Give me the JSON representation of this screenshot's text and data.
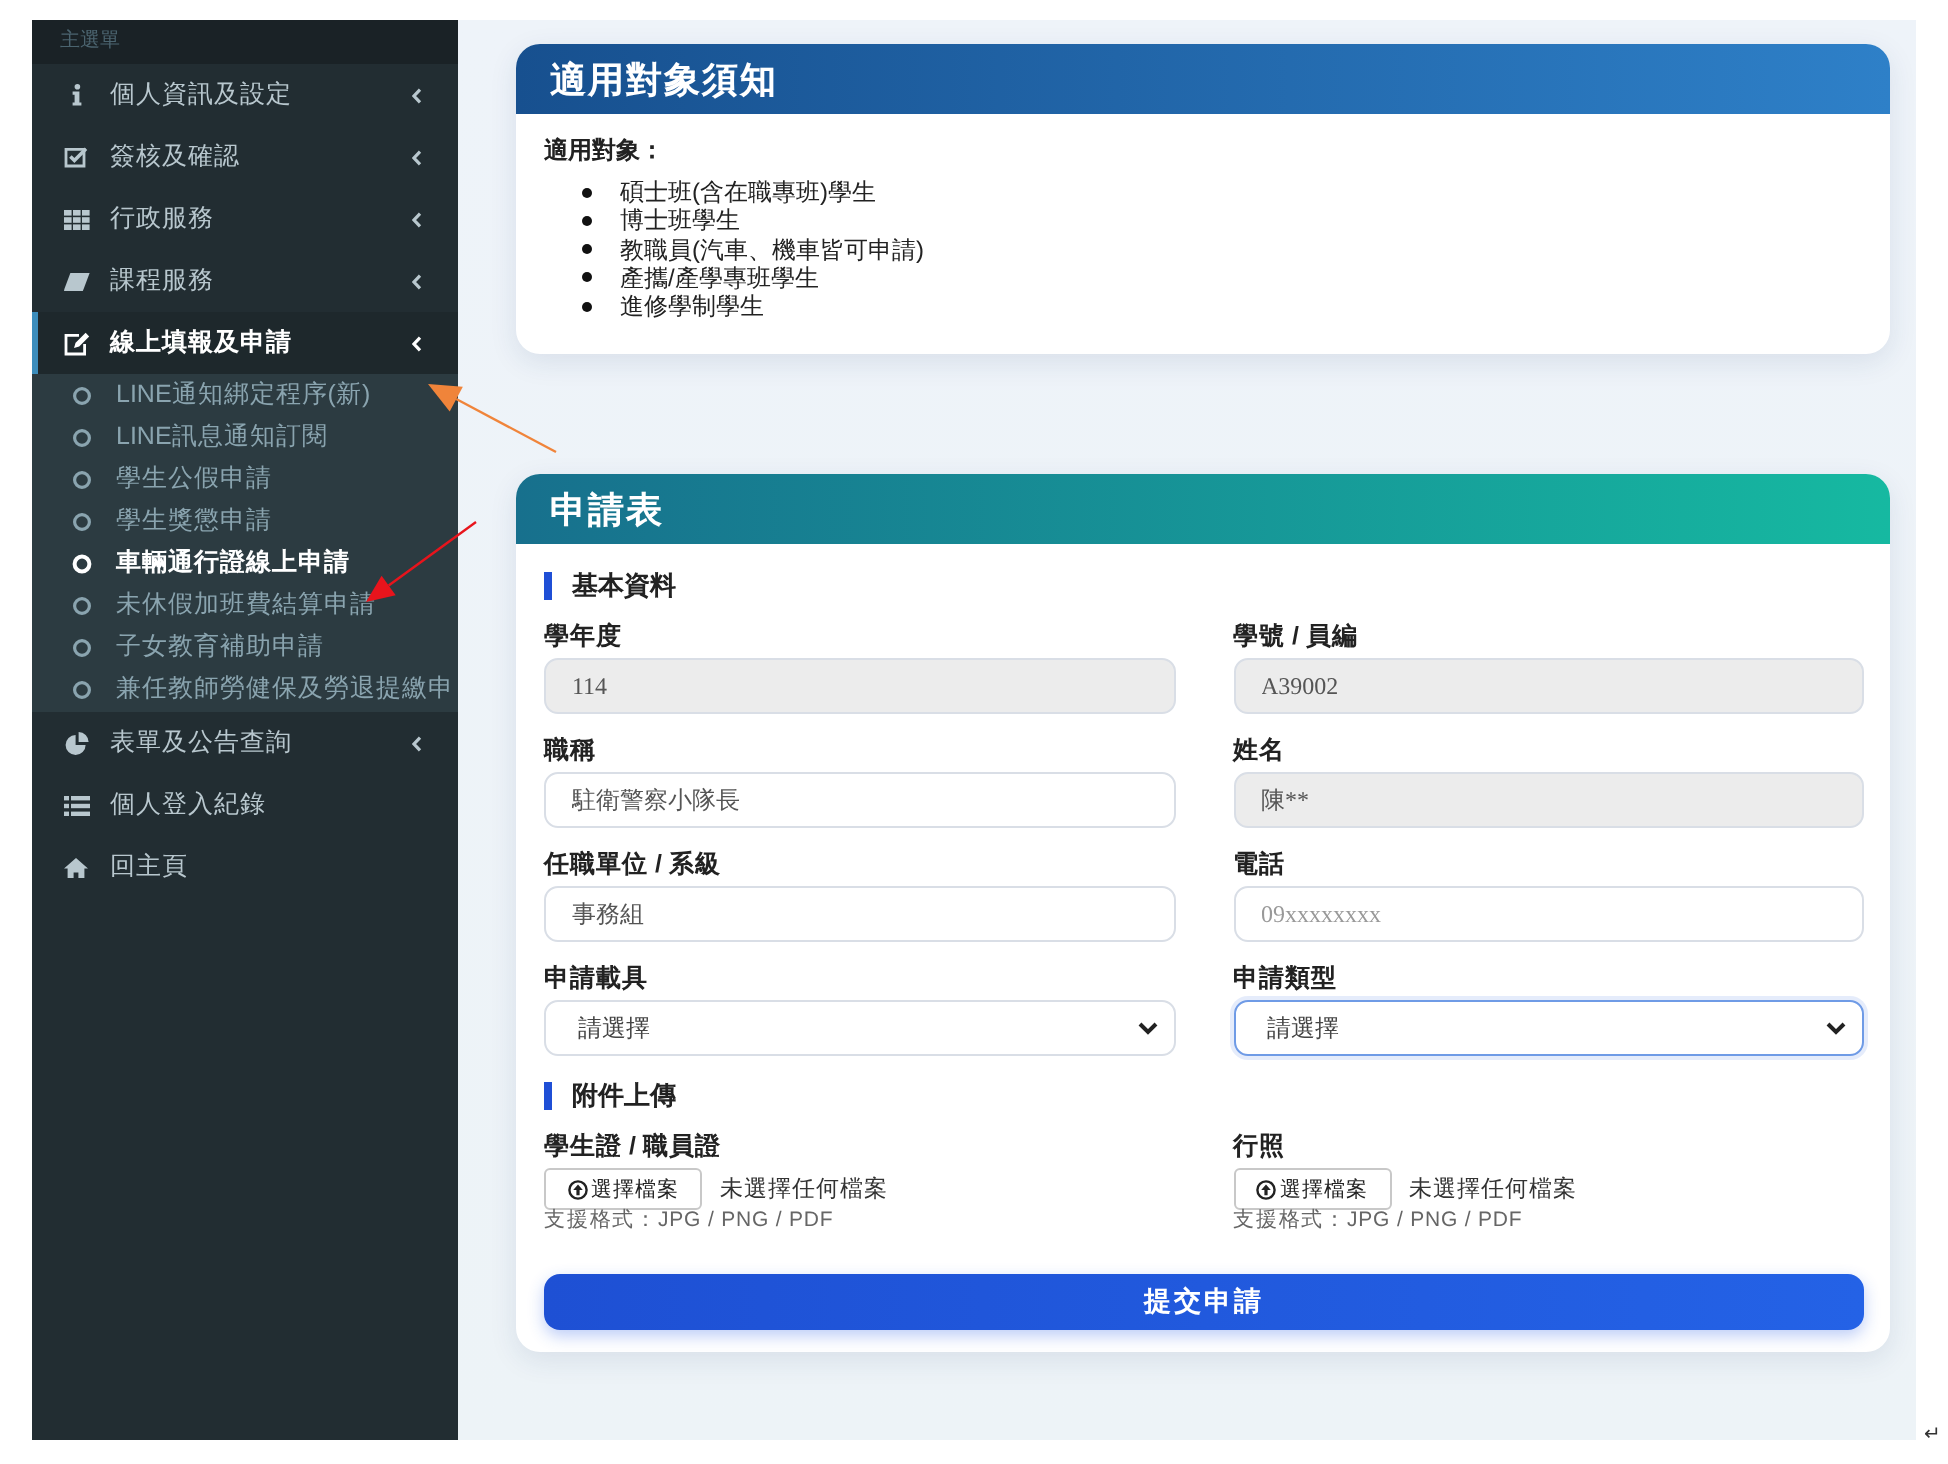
{
  "sidebar": {
    "header": "主選單",
    "items": [
      {
        "label": "個人資訊及設定",
        "expandable": true,
        "expanded": false,
        "selected": false
      },
      {
        "label": "簽核及確認",
        "expandable": true,
        "expanded": false,
        "selected": false
      },
      {
        "label": "行政服務",
        "expandable": true,
        "expanded": false,
        "selected": false
      },
      {
        "label": "課程服務",
        "expandable": true,
        "expanded": false,
        "selected": false
      },
      {
        "label": "線上填報及申請",
        "expandable": true,
        "expanded": true,
        "selected": true,
        "children": [
          {
            "label": "LINE通知綁定程序(新)",
            "selected": false
          },
          {
            "label": "LINE訊息通知訂閱",
            "selected": false
          },
          {
            "label": "學生公假申請",
            "selected": false
          },
          {
            "label": "學生獎懲申請",
            "selected": false
          },
          {
            "label": "車輛通行證線上申請",
            "selected": true
          },
          {
            "label": "未休假加班費結算申請",
            "selected": false
          },
          {
            "label": "子女教育補助申請",
            "selected": false
          },
          {
            "label": "兼任教師勞健保及勞退提繳申",
            "selected": false
          }
        ]
      },
      {
        "label": "表單及公告查詢",
        "expandable": true,
        "expanded": false,
        "selected": false
      },
      {
        "label": "個人登入紀錄",
        "expandable": false,
        "expanded": false,
        "selected": false
      },
      {
        "label": "回主頁",
        "expandable": false,
        "expanded": false,
        "selected": false
      }
    ]
  },
  "notice_card": {
    "title": "適用對象須知",
    "subtitle": "適用對象：",
    "items": [
      "碩士班(含在職專班)學生",
      "博士班學生",
      "教職員(汽車、機車皆可申請)",
      "產攜/產學專班學生",
      "進修學制學生"
    ]
  },
  "form_card": {
    "title": "申請表",
    "sections": [
      {
        "title": "基本資料",
        "fields": [
          {
            "kind": "input",
            "label": "學年度",
            "value": "114",
            "disabled": true,
            "focused": false
          },
          {
            "kind": "input",
            "label": "學號 / 員編",
            "value": "A39002",
            "disabled": true,
            "focused": false
          },
          {
            "kind": "input",
            "label": "職稱",
            "value": "駐衛警察小隊長",
            "disabled": false,
            "focused": false
          },
          {
            "kind": "input",
            "label": "姓名",
            "value": "陳**",
            "disabled": true,
            "focused": false
          },
          {
            "kind": "input",
            "label": "任職單位 / 系級",
            "value": "事務組",
            "disabled": false,
            "focused": false
          },
          {
            "kind": "input",
            "label": "電話",
            "placeholder": "09xxxxxxxx",
            "disabled": false,
            "focused": false
          },
          {
            "kind": "select",
            "label": "申請載具",
            "value": "請選擇",
            "focused": false
          },
          {
            "kind": "select",
            "label": "申請類型",
            "value": "請選擇",
            "focused": true
          }
        ]
      },
      {
        "title": "附件上傳",
        "fields": [
          {
            "kind": "file",
            "label": "學生證 / 職員證",
            "button": "選擇檔案",
            "status": "未選擇任何檔案",
            "hint": "支援格式：JPG / PNG / PDF"
          },
          {
            "kind": "file",
            "label": "行照",
            "button": "選擇檔案",
            "status": "未選擇任何檔案",
            "hint": "支援格式：JPG / PNG / PDF"
          }
        ]
      }
    ],
    "submit": "提交申請"
  },
  "annotation_arrows": [
    {
      "color": "#f0843a"
    },
    {
      "color": "#e8141c"
    }
  ],
  "paragraph_mark": "↵"
}
